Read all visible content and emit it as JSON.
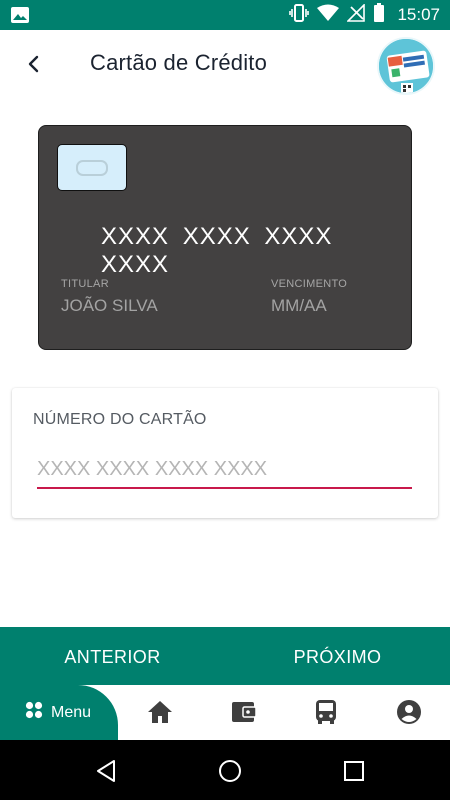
{
  "status_bar": {
    "time": "15:07",
    "icons": [
      "image-icon",
      "vibrate-icon",
      "wifi-icon",
      "no-signal-icon",
      "battery-icon"
    ]
  },
  "header": {
    "title": "Cartão de Crédito",
    "back_icon": "chevron-left-icon",
    "badge_icon": "bilhete-unico-logo"
  },
  "card_preview": {
    "number": "XXXX XXXX XXXX XXXX",
    "holder_label": "TITULAR",
    "holder_value": "JOÃO SILVA",
    "expiry_label": "VENCIMENTO",
    "expiry_value": "MM/AA"
  },
  "form": {
    "card_number_label": "NÚMERO DO CARTÃO",
    "card_number_placeholder": "XXXX XXXX XXXX XXXX",
    "card_number_value": ""
  },
  "actions": {
    "previous_label": "ANTERIOR",
    "next_label": "PRÓXIMO"
  },
  "tab_bar": {
    "menu_label": "Menu",
    "tabs": [
      "home-icon",
      "wallet-icon",
      "bus-icon",
      "account-icon"
    ]
  },
  "android_nav": [
    "back-triangle-icon",
    "home-circle-icon",
    "recents-square-icon"
  ],
  "colors": {
    "primary": "#00806e",
    "card_background": "#434141",
    "input_underline": "#c8194b"
  }
}
